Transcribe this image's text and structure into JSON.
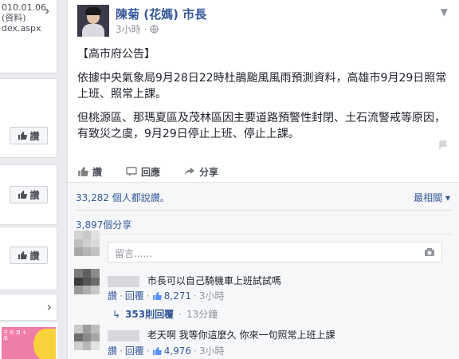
{
  "left_column": {
    "card1_lines": [
      "010.01.06.",
      "(資料)",
      "dex.aspx"
    ],
    "like_label": "讚",
    "promo_text": "子 的 目 十 品"
  },
  "post": {
    "page_name": "陳菊 (花媽) 市長",
    "timestamp": "3小時",
    "paragraphs": [
      "【高市府公告】",
      "依據中央氣象局9月28日22時杜鵑颱風風雨預測資料，高雄市9月29日照常上班、照常上課。",
      "但桃源區、那瑪夏區及茂林區因主要道路預警性封閉、土石流警戒等原因，有致災之虞，9月29日停止上班、停止上課。"
    ],
    "actions": {
      "like": "讚",
      "comment": "回應",
      "share": "分享"
    },
    "likes_summary": "33,282 個人都說讚。",
    "sort_label": "最相關 ▾",
    "shares": "3,897個分享",
    "comment_placeholder": "留言......"
  },
  "comments": [
    {
      "text": "市長可以自己騎機車上班試試嗎",
      "like": "讚",
      "reply": "回覆",
      "like_count": "8,271",
      "time": "3小時",
      "replies_label": "353則回覆",
      "replies_time": "13分鐘"
    },
    {
      "text": "老天啊 我等你這麼久 你來一句照常上班上課",
      "like": "讚",
      "reply": "回覆",
      "like_count": "4,976",
      "time": "3小時"
    }
  ],
  "colors": {
    "link": "#365899",
    "meta": "#90949c",
    "background": "#e9ebee"
  }
}
